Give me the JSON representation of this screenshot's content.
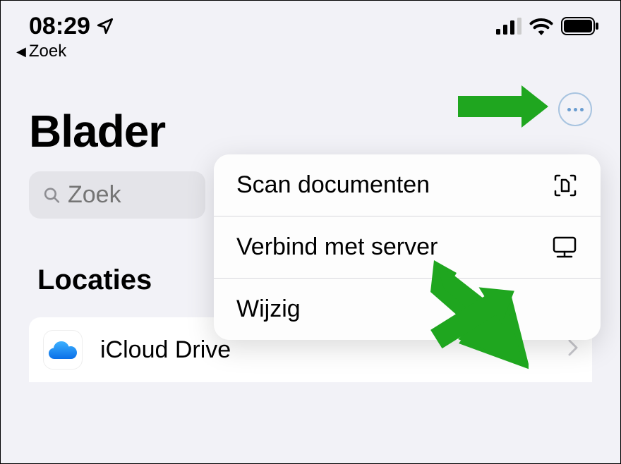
{
  "status": {
    "time": "08:29",
    "back_label": "Zoek"
  },
  "page": {
    "title": "Blader"
  },
  "search": {
    "placeholder": "Zoek"
  },
  "sections": {
    "locations_header": "Locaties"
  },
  "locations": [
    {
      "label": "iCloud Drive"
    }
  ],
  "menu": {
    "scan": "Scan documenten",
    "connect": "Verbind met server",
    "edit": "Wijzig"
  }
}
